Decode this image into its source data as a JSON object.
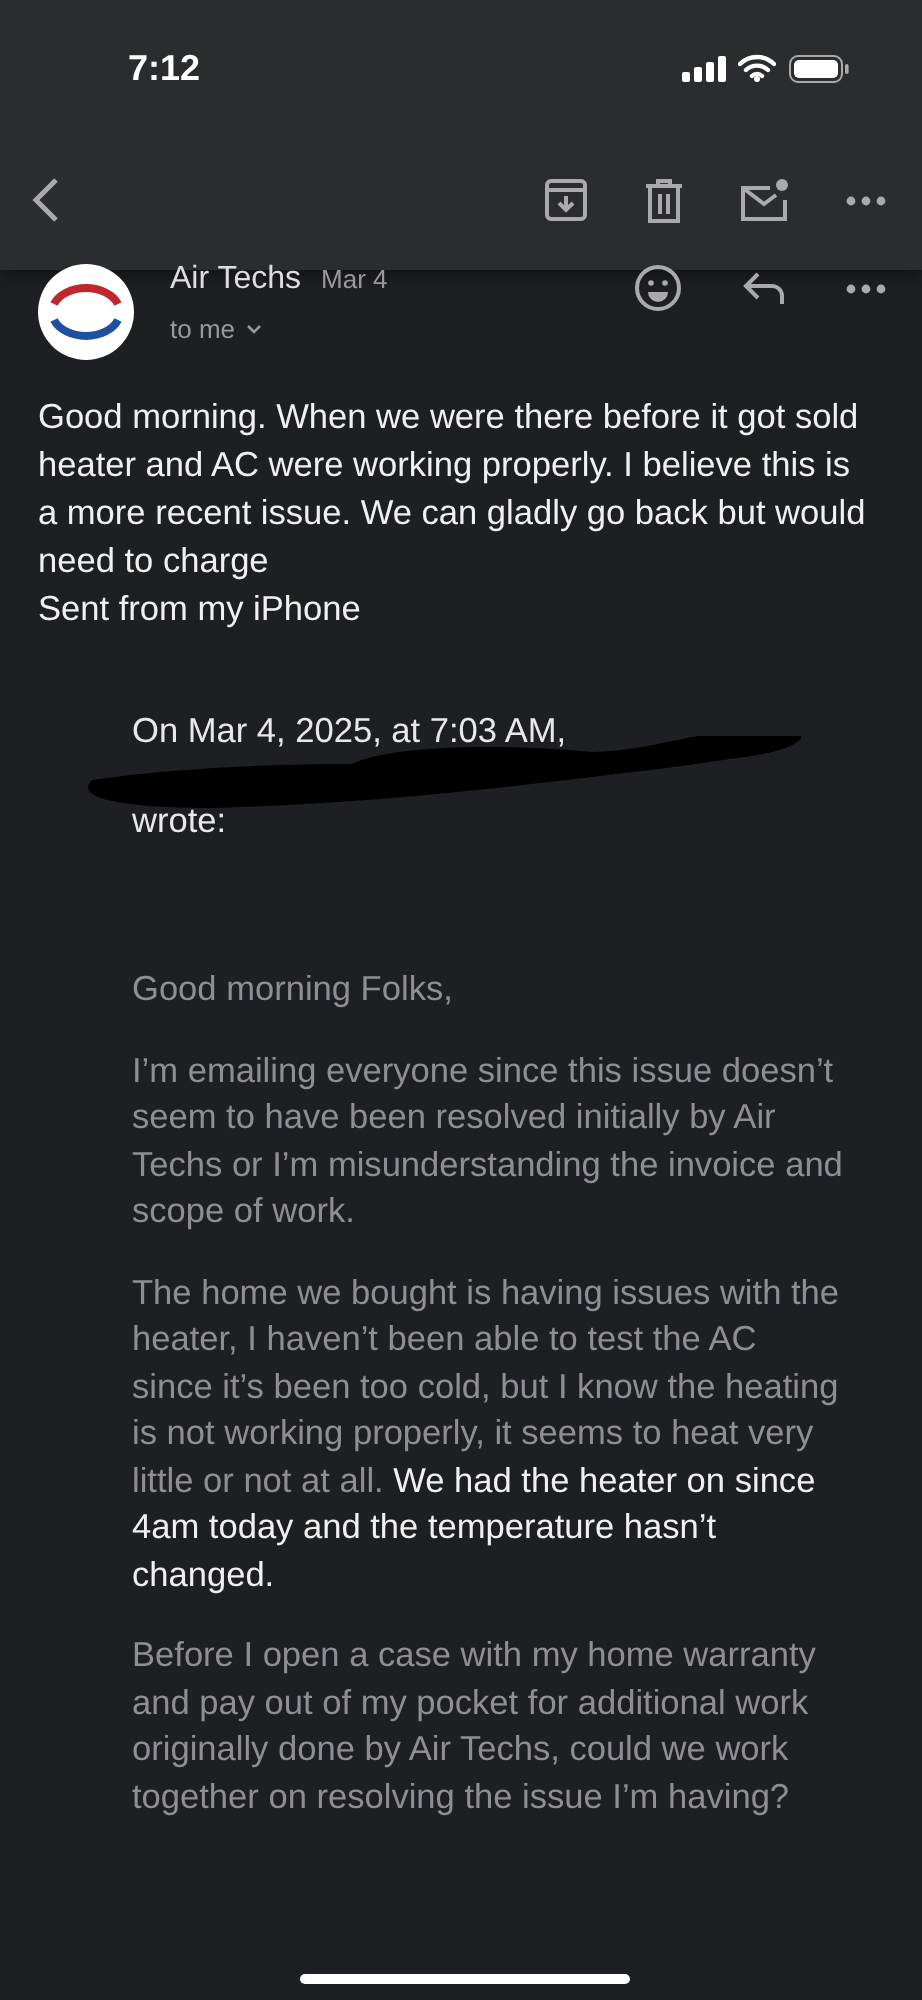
{
  "status_bar": {
    "time": "7:12"
  },
  "message": {
    "sender": "Air Techs",
    "date": "Mar 4",
    "recipient": "to me",
    "body": [
      "Good morning. When we were there before it got sold heater and AC were working properly. I believe this is a more recent issue. We can gladly go back but would need to charge",
      "Sent from my iPhone"
    ],
    "quote": {
      "header": "On Mar 4, 2025, at 7:03 AM,",
      "redacted": true,
      "wrote": "wrote:",
      "paragraphs": [
        [
          {
            "text": "Good morning Folks,",
            "highlighted": false
          }
        ],
        [
          {
            "text": "I’m emailing everyone since this issue doesn’t seem to have been resolved initially by Air Techs or I’m misunderstanding the invoice and scope of work.",
            "highlighted": false
          }
        ],
        [
          {
            "text": "The home we bought is having issues with the heater, I haven’t been able to test the AC since it’s been too cold, but I know the heating is not working properly, it seems to heat very little or not at all. ",
            "highlighted": false
          },
          {
            "text": "We had the heater on since 4am today and the temperature hasn’t changed.",
            "highlighted": true
          }
        ],
        [
          {
            "text": "Before I open a case with my home warranty and pay out of my pocket for additional work originally done by Air Techs, could we work together on resolving the issue I’m having?",
            "highlighted": false
          }
        ]
      ]
    }
  }
}
